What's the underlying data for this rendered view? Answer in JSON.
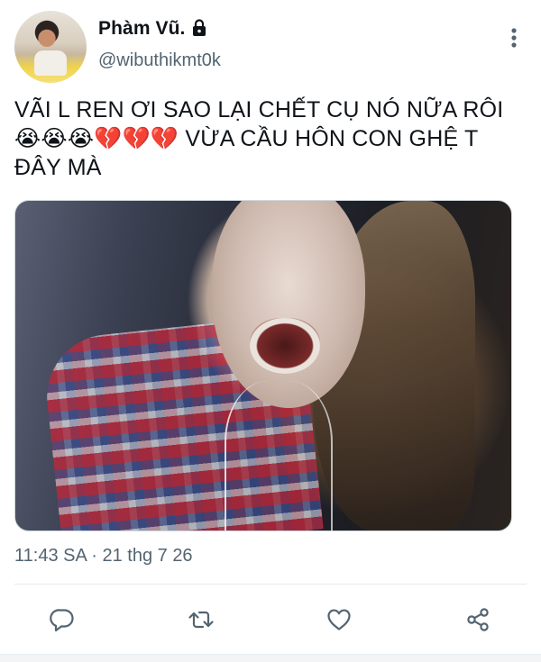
{
  "user": {
    "display_name": "Phàm Vũ.",
    "handle": "@wibuthikmt0k",
    "protected": true
  },
  "tweet": {
    "lines": [
      "VÃI L REN ƠI SAO LẠI CHẾT CỤ NÓ NỮA RÔI",
      "😭😭😭💔💔💔 VỪA CẦU HÔN CON GHỆ T",
      "ĐÂY MÀ"
    ],
    "timestamp": "11:43 SA · 21 thg 7 26"
  },
  "icons": {
    "lock": "lock-icon",
    "more": "more-vertical-icon",
    "reply": "reply-icon",
    "retweet": "retweet-icon",
    "like": "like-icon",
    "share": "share-icon"
  },
  "colors": {
    "text": "#0f1419",
    "secondary": "#536471",
    "divider": "#e6ecf0"
  }
}
